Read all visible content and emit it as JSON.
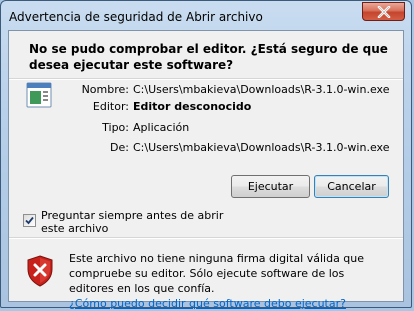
{
  "window": {
    "title": "Advertencia de seguridad de Abrir archivo"
  },
  "dialog": {
    "question": "No se pudo comprobar el editor. ¿Está seguro de que desea ejecutar este software?",
    "details": {
      "name_label": "Nombre:",
      "name_value": "C:\\Users\\mbakieva\\Downloads\\R-3.1.0-win.exe",
      "publisher_label": "Editor:",
      "publisher_value": "Editor desconocido",
      "type_label": "Tipo:",
      "type_value": "Aplicación",
      "from_label": "De:",
      "from_value": "C:\\Users\\mbakieva\\Downloads\\R-3.1.0-win.exe"
    },
    "buttons": {
      "run_label": "Ejecutar",
      "cancel_label": "Cancelar"
    },
    "checkbox": {
      "label": "Preguntar siempre antes de abrir este archivo",
      "checked": true
    },
    "footer": {
      "warning_text": "Este archivo no tiene ninguna firma digital válida que compruebe su editor. Sólo ejecute software de los editores en los que confía.",
      "help_link": "¿Cómo puedo decidir qué software debo ejecutar?"
    }
  },
  "icons": {
    "close": "close-icon",
    "app": "application-icon",
    "shield": "security-warning-shield-icon",
    "check": "checkmark-icon"
  },
  "colors": {
    "link": "#0066cc",
    "shield_red": "#c8211b",
    "close_red": "#c4452d"
  }
}
